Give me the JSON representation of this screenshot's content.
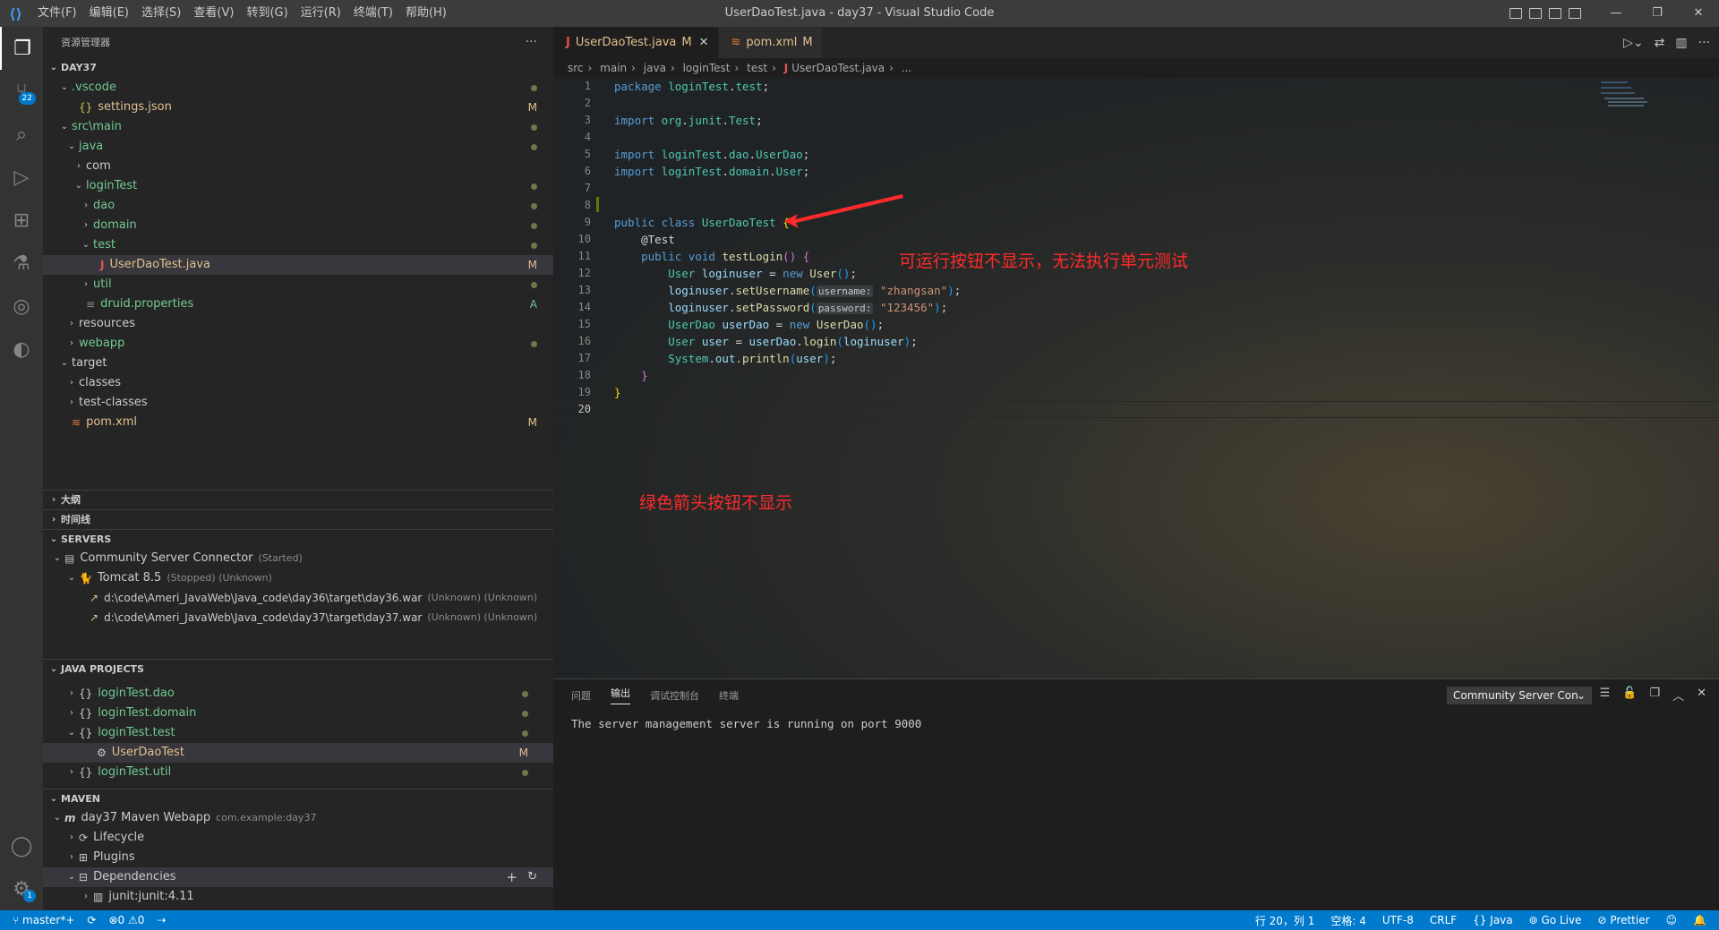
{
  "title_bar": {
    "menus": [
      "文件(F)",
      "编辑(E)",
      "选择(S)",
      "查看(V)",
      "转到(G)",
      "运行(R)",
      "终端(T)",
      "帮助(H)"
    ],
    "window_title": "UserDaoTest.java - day37 - Visual Studio Code"
  },
  "activity_bar": {
    "scm_badge": "22",
    "settings_badge": "1"
  },
  "explorer": {
    "header": "资源管理器",
    "root": "DAY37",
    "tree": [
      {
        "label": ".vscode",
        "indent": 1,
        "twisty": "open",
        "deco": "dot"
      },
      {
        "label": "settings.json",
        "indent": 2,
        "icon": "{}",
        "deco": "M"
      },
      {
        "label": "src\\main",
        "indent": 1,
        "twisty": "open",
        "deco": "dot"
      },
      {
        "label": "java",
        "indent": 2,
        "twisty": "open",
        "deco": "dot"
      },
      {
        "label": "com",
        "indent": 3,
        "twisty": "closed",
        "deco": ""
      },
      {
        "label": "loginTest",
        "indent": 3,
        "twisty": "open",
        "deco": "dot"
      },
      {
        "label": "dao",
        "indent": 4,
        "twisty": "closed",
        "deco": "dot"
      },
      {
        "label": "domain",
        "indent": 4,
        "twisty": "closed",
        "deco": "dot"
      },
      {
        "label": "test",
        "indent": 4,
        "twisty": "open",
        "deco": "dot"
      },
      {
        "label": "UserDaoTest.java",
        "indent": 5,
        "icon": "J",
        "deco": "M",
        "selected": true
      },
      {
        "label": "util",
        "indent": 4,
        "twisty": "closed",
        "deco": "dot"
      },
      {
        "label": "druid.properties",
        "indent": 3,
        "icon": "≡",
        "deco": "A"
      },
      {
        "label": "resources",
        "indent": 2,
        "twisty": "closed",
        "deco": ""
      },
      {
        "label": "webapp",
        "indent": 2,
        "twisty": "closed",
        "deco": "dot"
      },
      {
        "label": "target",
        "indent": 1,
        "twisty": "open",
        "deco": ""
      },
      {
        "label": "classes",
        "indent": 2,
        "twisty": "closed",
        "deco": ""
      },
      {
        "label": "test-classes",
        "indent": 2,
        "twisty": "closed",
        "deco": ""
      },
      {
        "label": "pom.xml",
        "indent": 1,
        "icon": "rss",
        "deco": "M"
      }
    ]
  },
  "sections": {
    "outline": "大纲",
    "timeline": "时间线",
    "servers": "SERVERS",
    "java_projects": "JAVA PROJECTS",
    "maven": "MAVEN"
  },
  "servers": {
    "connector": "Community Server Connector",
    "connector_state": "(Started)",
    "tomcat": "Tomcat 8.5",
    "tomcat_state": "(Stopped) (Unknown)",
    "deployments": [
      {
        "path": "d:\\code\\Ameri_JavaWeb\\Java_code\\day36\\target\\day36.war",
        "state": "(Unknown) (Unknown)"
      },
      {
        "path": "d:\\code\\Ameri_JavaWeb\\Java_code\\day37\\target\\day37.war",
        "state": "(Unknown) (Unknown)"
      }
    ]
  },
  "java_projects": {
    "items": [
      {
        "label": "loginTest.dao",
        "twisty": "closed",
        "deco": "dot"
      },
      {
        "label": "loginTest.domain",
        "twisty": "closed",
        "deco": "dot"
      },
      {
        "label": "loginTest.test",
        "twisty": "open",
        "deco": "dot"
      },
      {
        "label": "UserDaoTest",
        "child": true,
        "deco": "M",
        "selected": true
      },
      {
        "label": "loginTest.util",
        "twisty": "closed",
        "deco": "dot"
      }
    ]
  },
  "maven": {
    "project": "day37 Maven Webapp",
    "project_id": "com.example:day37",
    "lifecycle": "Lifecycle",
    "plugins": "Plugins",
    "dependencies": "Dependencies",
    "dep_junit": "junit:junit:4.11"
  },
  "editor": {
    "tabs": [
      {
        "label": "UserDaoTest.java",
        "mark": "M",
        "active": true
      },
      {
        "label": "pom.xml",
        "mark": "M",
        "active": false
      }
    ],
    "breadcrumbs": [
      "src",
      "main",
      "java",
      "loginTest",
      "test",
      "UserDaoTest.java",
      "..."
    ],
    "line_numbers": [
      "1",
      "2",
      "3",
      "4",
      "5",
      "6",
      "7",
      "8",
      "9",
      "10",
      "11",
      "12",
      "13",
      "14",
      "15",
      "16",
      "17",
      "18",
      "19",
      "20"
    ],
    "current_line": "20",
    "annotation_run": "可运行按钮不显示，无法执行单元测试",
    "annotation_arrow": "绿色箭头按钮不显示"
  },
  "panel": {
    "tabs": [
      "问题",
      "输出",
      "调试控制台",
      "终端"
    ],
    "active_tab": "输出",
    "channel": "Community Server Con",
    "output": "The server management server is running on port 9000"
  },
  "status_bar": {
    "branch": "master*+",
    "errors": "0",
    "warnings": "0",
    "position": "行 20，列 1",
    "spaces": "空格: 4",
    "encoding": "UTF-8",
    "eol": "CRLF",
    "language": "Java",
    "golive": "Go Live",
    "prettier": "Prettier"
  },
  "colors": {
    "accent": "#007acc",
    "modified": "#e2c08d",
    "added": "#73c991",
    "annotation": "#ff2a2a"
  }
}
